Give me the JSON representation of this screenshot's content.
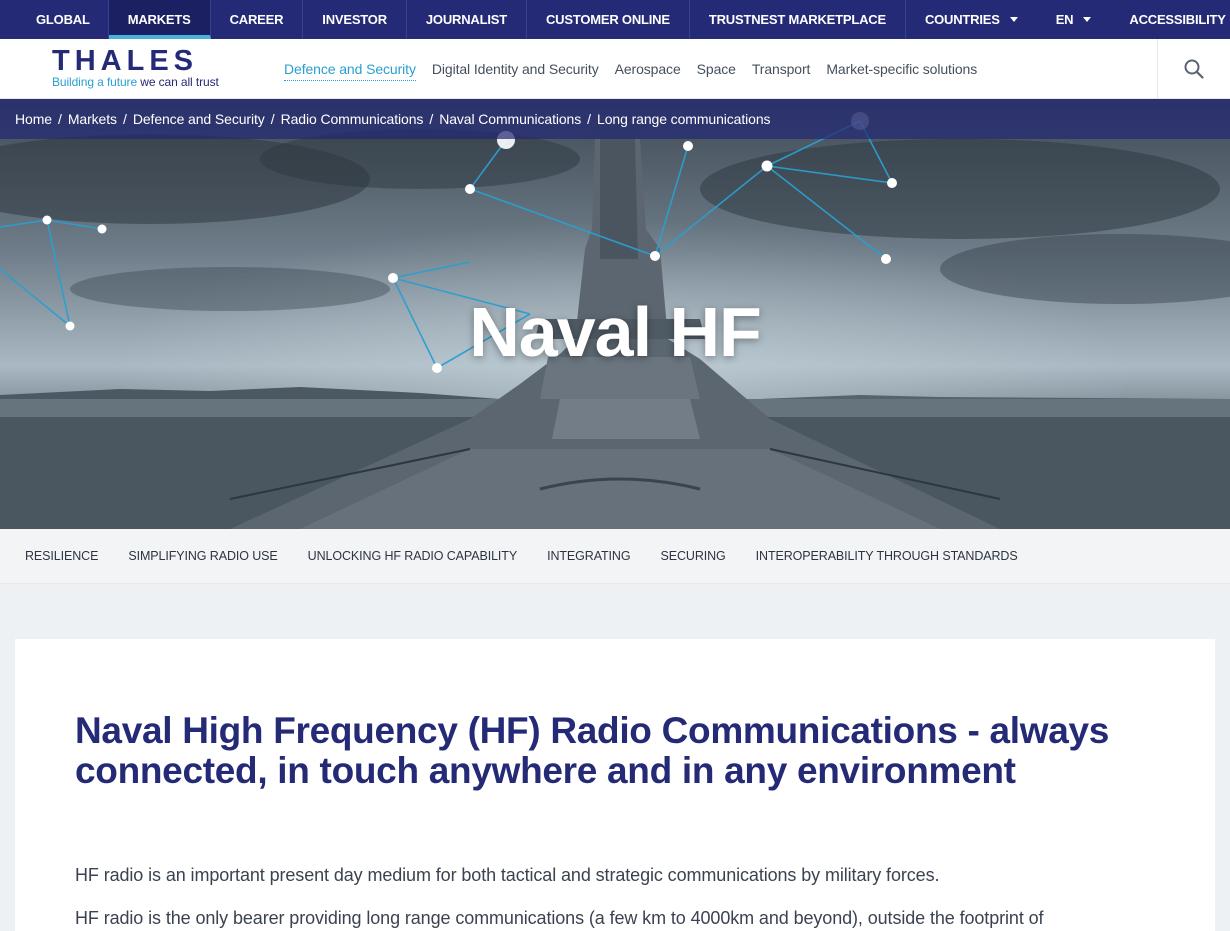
{
  "topbar": {
    "left": [
      {
        "label": "GLOBAL"
      },
      {
        "label": "MARKETS",
        "active": true
      },
      {
        "label": "CAREER"
      },
      {
        "label": "INVESTOR"
      },
      {
        "label": "JOURNALIST"
      },
      {
        "label": "CUSTOMER ONLINE"
      },
      {
        "label": "TRUSTNEST MARKETPLACE"
      }
    ],
    "right": [
      {
        "label": "COUNTRIES"
      },
      {
        "label": "EN"
      },
      {
        "label": "ACCESSIBILITY"
      }
    ]
  },
  "header": {
    "logo_text": "THALES",
    "tagline_prefix": "Building a future",
    "tagline_suffix": " we can all trust",
    "nav": [
      {
        "label": "Defence and Security",
        "active": true
      },
      {
        "label": "Digital Identity and Security"
      },
      {
        "label": "Aerospace"
      },
      {
        "label": "Space"
      },
      {
        "label": "Transport"
      },
      {
        "label": "Market-specific solutions"
      }
    ],
    "search_icon": "search-icon"
  },
  "breadcrumb": [
    "Home",
    "Markets",
    "Defence and Security",
    "Radio Communications",
    "Naval Communications",
    "Long range communications"
  ],
  "hero": {
    "title": "Naval HF"
  },
  "anchors": [
    "RESILIENCE",
    "SIMPLIFYING RADIO USE",
    "UNLOCKING HF RADIO CAPABILITY",
    "INTEGRATING",
    "SECURING",
    "INTEROPERABILITY THROUGH STANDARDS"
  ],
  "content": {
    "heading": "Naval High Frequency (HF) Radio Communications - always connected, in touch anywhere and in any environment",
    "p1": "HF radio is an important present day medium for both tactical and strategic communications by military forces.",
    "p2": "HF radio is the only bearer providing long range communications (a few km to 4000km and beyond), outside the footprint of"
  },
  "colors": {
    "brand_navy": "#242a75",
    "accent_cyan": "#2a9fd0",
    "active_underline": "#46b3d7"
  }
}
